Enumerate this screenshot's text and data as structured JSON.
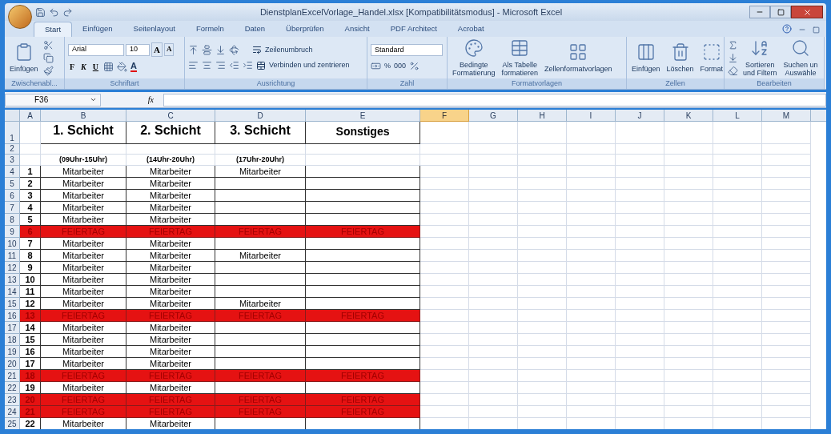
{
  "window": {
    "title": "DienstplanExcelVorlage_Handel.xlsx  [Kompatibilitätsmodus] - Microsoft Excel"
  },
  "tabs": [
    {
      "label": "Start",
      "selected": true
    },
    {
      "label": "Einfügen",
      "selected": false
    },
    {
      "label": "Seitenlayout",
      "selected": false
    },
    {
      "label": "Formeln",
      "selected": false
    },
    {
      "label": "Daten",
      "selected": false
    },
    {
      "label": "Überprüfen",
      "selected": false
    },
    {
      "label": "Ansicht",
      "selected": false
    },
    {
      "label": "PDF Architect",
      "selected": false
    },
    {
      "label": "Acrobat",
      "selected": false
    }
  ],
  "ribbon": {
    "clipboard": {
      "label": "Zwischenabl...",
      "paste": "Einfügen"
    },
    "font": {
      "label": "Schriftart",
      "font_name": "Arial",
      "font_size": "10",
      "grow": "A",
      "shrink": "A",
      "bold": "F",
      "italic": "K",
      "underline": "U",
      "font_color": "A"
    },
    "alignment": {
      "label": "Ausrichtung",
      "wrap": "Zeilenumbruch",
      "merge": "Verbinden und zentrieren"
    },
    "number": {
      "label": "Zahl",
      "format": "Standard",
      "percent": "%",
      "thousands": "000"
    },
    "styles": {
      "label": "Formatvorlagen",
      "buttons": [
        {
          "lines": [
            "Bedingte",
            "Formatierung"
          ]
        },
        {
          "lines": [
            "Als Tabelle",
            "formatieren"
          ]
        },
        {
          "lines": [
            "Zellenformatvorlagen"
          ]
        }
      ]
    },
    "cells": {
      "label": "Zellen",
      "buttons": [
        {
          "lines": [
            "Einfügen"
          ]
        },
        {
          "lines": [
            "Löschen"
          ]
        },
        {
          "lines": [
            "Format"
          ]
        }
      ]
    },
    "editing": {
      "label": "Bearbeiten",
      "buttons": [
        {
          "lines": [
            "Sortieren",
            "und Filtern"
          ]
        },
        {
          "lines": [
            "Suchen un",
            "Auswähle"
          ]
        }
      ]
    }
  },
  "formula_bar": {
    "name_box": "F36",
    "fx": "fx"
  },
  "sheet": {
    "columns": [
      {
        "label": "A",
        "selected": false
      },
      {
        "label": "B",
        "selected": false
      },
      {
        "label": "C",
        "selected": false
      },
      {
        "label": "D",
        "selected": false
      },
      {
        "label": "E",
        "selected": false
      },
      {
        "label": "F",
        "selected": true
      },
      {
        "label": "G",
        "selected": false
      },
      {
        "label": "H",
        "selected": false
      },
      {
        "label": "I",
        "selected": false
      },
      {
        "label": "J",
        "selected": false
      },
      {
        "label": "K",
        "selected": false
      },
      {
        "label": "L",
        "selected": false
      },
      {
        "label": "M",
        "selected": false
      }
    ],
    "rows": [
      {
        "number": "1",
        "kind": "title",
        "cells": {
          "B": "1. Schicht",
          "C": "2. Schicht",
          "D": "3. Schicht",
          "E": "Sonstiges"
        }
      },
      {
        "number": "2",
        "kind": "blank"
      },
      {
        "number": "3",
        "kind": "subtitle",
        "cells": {
          "B": "(09Uhr-15Uhr)",
          "C": "(14Uhr-20Uhr)",
          "D": "(17Uhr-20Uhr)"
        }
      },
      {
        "number": "4",
        "kind": "entry",
        "holiday": false,
        "cells": {
          "A": "1",
          "B": "Mitarbeiter",
          "C": "Mitarbeiter",
          "D": "Mitarbeiter"
        }
      },
      {
        "number": "5",
        "kind": "entry",
        "holiday": false,
        "cells": {
          "A": "2",
          "B": "Mitarbeiter",
          "C": "Mitarbeiter"
        }
      },
      {
        "number": "6",
        "kind": "entry",
        "holiday": false,
        "cells": {
          "A": "3",
          "B": "Mitarbeiter",
          "C": "Mitarbeiter"
        }
      },
      {
        "number": "7",
        "kind": "entry",
        "holiday": false,
        "cells": {
          "A": "4",
          "B": "Mitarbeiter",
          "C": "Mitarbeiter"
        }
      },
      {
        "number": "8",
        "kind": "entry",
        "holiday": false,
        "cells": {
          "A": "5",
          "B": "Mitarbeiter",
          "C": "Mitarbeiter"
        }
      },
      {
        "number": "9",
        "kind": "entry",
        "holiday": true,
        "cells": {
          "A": "6",
          "B": "FEIERTAG",
          "C": "FEIERTAG",
          "D": "FEIERTAG",
          "E": "FEIERTAG"
        }
      },
      {
        "number": "10",
        "kind": "entry",
        "holiday": false,
        "cells": {
          "A": "7",
          "B": "Mitarbeiter",
          "C": "Mitarbeiter"
        }
      },
      {
        "number": "11",
        "kind": "entry",
        "holiday": false,
        "cells": {
          "A": "8",
          "B": "Mitarbeiter",
          "C": "Mitarbeiter",
          "D": "Mitarbeiter"
        }
      },
      {
        "number": "12",
        "kind": "entry",
        "holiday": false,
        "cells": {
          "A": "9",
          "B": "Mitarbeiter",
          "C": "Mitarbeiter"
        }
      },
      {
        "number": "13",
        "kind": "entry",
        "holiday": false,
        "cells": {
          "A": "10",
          "B": "Mitarbeiter",
          "C": "Mitarbeiter"
        }
      },
      {
        "number": "14",
        "kind": "entry",
        "holiday": false,
        "cells": {
          "A": "11",
          "B": "Mitarbeiter",
          "C": "Mitarbeiter"
        }
      },
      {
        "number": "15",
        "kind": "entry",
        "holiday": false,
        "cells": {
          "A": "12",
          "B": "Mitarbeiter",
          "C": "Mitarbeiter",
          "D": "Mitarbeiter"
        }
      },
      {
        "number": "16",
        "kind": "entry",
        "holiday": true,
        "cells": {
          "A": "13",
          "B": "FEIERTAG",
          "C": "FEIERTAG",
          "D": "FEIERTAG",
          "E": "FEIERTAG"
        }
      },
      {
        "number": "17",
        "kind": "entry",
        "holiday": false,
        "cells": {
          "A": "14",
          "B": "Mitarbeiter",
          "C": "Mitarbeiter"
        }
      },
      {
        "number": "18",
        "kind": "entry",
        "holiday": false,
        "cells": {
          "A": "15",
          "B": "Mitarbeiter",
          "C": "Mitarbeiter"
        }
      },
      {
        "number": "19",
        "kind": "entry",
        "holiday": false,
        "cells": {
          "A": "16",
          "B": "Mitarbeiter",
          "C": "Mitarbeiter"
        }
      },
      {
        "number": "20",
        "kind": "entry",
        "holiday": false,
        "cells": {
          "A": "17",
          "B": "Mitarbeiter",
          "C": "Mitarbeiter"
        }
      },
      {
        "number": "21",
        "kind": "entry",
        "holiday": true,
        "cells": {
          "A": "18",
          "B": "FEIERTAG",
          "C": "FEIERTAG",
          "D": "FEIERTAG",
          "E": "FEIERTAG"
        }
      },
      {
        "number": "22",
        "kind": "entry",
        "holiday": false,
        "cells": {
          "A": "19",
          "B": "Mitarbeiter",
          "C": "Mitarbeiter"
        }
      },
      {
        "number": "23",
        "kind": "entry",
        "holiday": true,
        "cells": {
          "A": "20",
          "B": "FEIERTAG",
          "C": "FEIERTAG",
          "D": "FEIERTAG",
          "E": "FEIERTAG"
        }
      },
      {
        "number": "24",
        "kind": "entry",
        "holiday": true,
        "cells": {
          "A": "21",
          "B": "FEIERTAG",
          "C": "FEIERTAG",
          "D": "FEIERTAG",
          "E": "FEIERTAG"
        }
      },
      {
        "number": "25",
        "kind": "entry",
        "holiday": false,
        "cells": {
          "A": "22",
          "B": "Mitarbeiter",
          "C": "Mitarbeiter"
        }
      }
    ]
  }
}
